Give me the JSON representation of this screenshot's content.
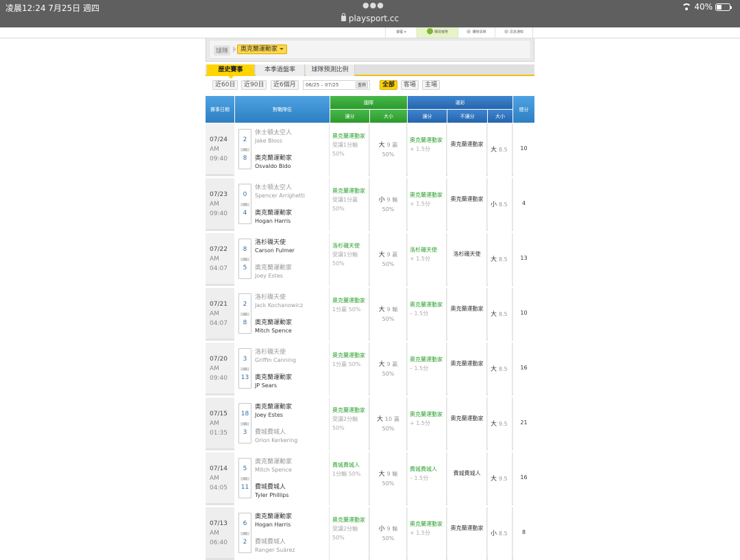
{
  "status": {
    "time": "凌晨12:24   7月25日 週四",
    "url": "playsport.cc",
    "battery": "40%",
    "battery_level": 0.4
  },
  "topnav": {
    "member": "靜藝 ▾",
    "buy": "購買噱幣",
    "cart": "購物清單",
    "msg": "訊息通知"
  },
  "team_select": {
    "label": "球隊",
    "team": "奧克蘭運動家"
  },
  "tabs": [
    "歷史賽事",
    "本季過盤率",
    "球隊預測比例"
  ],
  "filters": {
    "ranges": [
      "近60日",
      "近90日",
      "近6個月"
    ],
    "date_from": "06/25",
    "date_sep": "–",
    "date_to": "07/25",
    "query": "查詢",
    "sides": [
      "全部",
      "客場",
      "主場"
    ]
  },
  "headers": {
    "date": "賽事日期",
    "matchup": "對戰隊伍",
    "intl": "國際",
    "sports": "運彩",
    "spread": "讓分",
    "ou": "大小",
    "sp_spread": "讓分",
    "sp_no": "不讓分",
    "sp_ou": "大小",
    "total": "總分"
  },
  "rows": [
    {
      "date": "07/24",
      "ampm": "AM",
      "time": "09:40",
      "away": {
        "team": "休士頓太空人",
        "pitcher": "Jake Bloss",
        "score": "2",
        "won": false
      },
      "home": {
        "team": "奧克蘭運動家",
        "pitcher": "Osvaldo Bido",
        "score": "8",
        "won": true
      },
      "intl_spread": "奧克蘭運動家",
      "intl_spread_res": "受讓1分輸 50%",
      "ou_dir": "大",
      "ou_line": "9",
      "ou_res": "贏",
      "ou_pct": "50%",
      "sp_spread": "奧克蘭運動家",
      "sp_spread_line": "+ 1.5分",
      "sp_no": "奧克蘭運動家",
      "sp_ou_dir": "大",
      "sp_ou_line": "8.5",
      "total": "10"
    },
    {
      "date": "07/23",
      "ampm": "AM",
      "time": "09:40",
      "away": {
        "team": "休士頓太空人",
        "pitcher": "Spencer Arrighetti",
        "score": "0",
        "won": false
      },
      "home": {
        "team": "奧克蘭運動家",
        "pitcher": "Hogan Harris",
        "score": "4",
        "won": true
      },
      "intl_spread": "奧克蘭運動家",
      "intl_spread_res": "受讓1分贏 50%",
      "ou_dir": "小",
      "ou_line": "9",
      "ou_res": "輸",
      "ou_pct": "50%",
      "sp_spread": "奧克蘭運動家",
      "sp_spread_line": "+ 1.5分",
      "sp_no": "奧克蘭運動家",
      "sp_ou_dir": "小",
      "sp_ou_line": "8.5",
      "total": "4"
    },
    {
      "date": "07/22",
      "ampm": "AM",
      "time": "04:07",
      "away": {
        "team": "洛杉磯天使",
        "pitcher": "Carson Fulmer",
        "score": "8",
        "won": true
      },
      "home": {
        "team": "奧克蘭運動家",
        "pitcher": "Joey Estes",
        "score": "5",
        "won": false
      },
      "intl_spread": "洛杉磯天使",
      "intl_spread_res": "受讓1分輸 50%",
      "ou_dir": "大",
      "ou_line": "9",
      "ou_res": "贏",
      "ou_pct": "50%",
      "sp_spread": "洛杉磯天使",
      "sp_spread_line": "+ 1.5分",
      "sp_no": "洛杉磯天使",
      "sp_ou_dir": "大",
      "sp_ou_line": "8.5",
      "total": "13"
    },
    {
      "date": "07/21",
      "ampm": "AM",
      "time": "04:07",
      "away": {
        "team": "洛杉磯天使",
        "pitcher": "Jack Kochanowicz",
        "score": "2",
        "won": false
      },
      "home": {
        "team": "奧克蘭運動家",
        "pitcher": "Mitch Spence",
        "score": "8",
        "won": true
      },
      "intl_spread": "奧克蘭運動家",
      "intl_spread_res": "1分贏 50%",
      "ou_dir": "大",
      "ou_line": "9",
      "ou_res": "輸",
      "ou_pct": "50%",
      "sp_spread": "奧克蘭運動家",
      "sp_spread_line": "– 1.5分",
      "sp_no": "奧克蘭運動家",
      "sp_ou_dir": "大",
      "sp_ou_line": "8.5",
      "total": "10"
    },
    {
      "date": "07/20",
      "ampm": "AM",
      "time": "09:40",
      "away": {
        "team": "洛杉磯天使",
        "pitcher": "Griffin Canning",
        "score": "3",
        "won": false
      },
      "home": {
        "team": "奧克蘭運動家",
        "pitcher": "JP Sears",
        "score": "13",
        "won": true
      },
      "intl_spread": "奧克蘭運動家",
      "intl_spread_res": "1分贏 50%",
      "ou_dir": "大",
      "ou_line": "9",
      "ou_res": "贏",
      "ou_pct": "50%",
      "sp_spread": "奧克蘭運動家",
      "sp_spread_line": "– 1.5分",
      "sp_no": "奧克蘭運動家",
      "sp_ou_dir": "大",
      "sp_ou_line": "8.5",
      "total": "16"
    },
    {
      "date": "07/15",
      "ampm": "AM",
      "time": "01:35",
      "away": {
        "team": "奧克蘭運動家",
        "pitcher": "Joey Estes",
        "score": "18",
        "won": true
      },
      "home": {
        "team": "費城費城人",
        "pitcher": "Orion Kerkering",
        "score": "3",
        "won": false
      },
      "intl_spread": "奧克蘭運動家",
      "intl_spread_res": "受讓2分輸 50%",
      "ou_dir": "大",
      "ou_line": "10",
      "ou_res": "贏",
      "ou_pct": "50%",
      "sp_spread": "奧克蘭運動家",
      "sp_spread_line": "+ 1.5分",
      "sp_no": "奧克蘭運動家",
      "sp_ou_dir": "大",
      "sp_ou_line": "9.5",
      "total": "21"
    },
    {
      "date": "07/14",
      "ampm": "AM",
      "time": "04:05",
      "away": {
        "team": "奧克蘭運動家",
        "pitcher": "Mitch Spence",
        "score": "5",
        "won": false
      },
      "home": {
        "team": "費城費城人",
        "pitcher": "Tyler Phillips",
        "score": "11",
        "won": true
      },
      "intl_spread": "費城費城人",
      "intl_spread_res": "1分輸 50%",
      "ou_dir": "大",
      "ou_line": "9",
      "ou_res": "輸",
      "ou_pct": "50%",
      "sp_spread": "費城費城人",
      "sp_spread_line": "– 1.5分",
      "sp_no": "費城費城人",
      "sp_ou_dir": "大",
      "sp_ou_line": "9.5",
      "total": "16"
    },
    {
      "date": "07/13",
      "ampm": "AM",
      "time": "06:40",
      "away": {
        "team": "奧克蘭運動家",
        "pitcher": "Hogan Harris",
        "score": "6",
        "won": true
      },
      "home": {
        "team": "費城費城人",
        "pitcher": "Ranger Suárez",
        "score": "2",
        "won": false
      },
      "intl_spread": "奧克蘭運動家",
      "intl_spread_res": "受讓2分輸 50%",
      "ou_dir": "小",
      "ou_line": "9",
      "ou_res": "輸",
      "ou_pct": "50%",
      "sp_spread": "奧克蘭運動家",
      "sp_spread_line": "+ 1.5分",
      "sp_no": "奧克蘭運動家",
      "sp_ou_dir": "小",
      "sp_ou_line": "8.5",
      "total": "8"
    }
  ]
}
